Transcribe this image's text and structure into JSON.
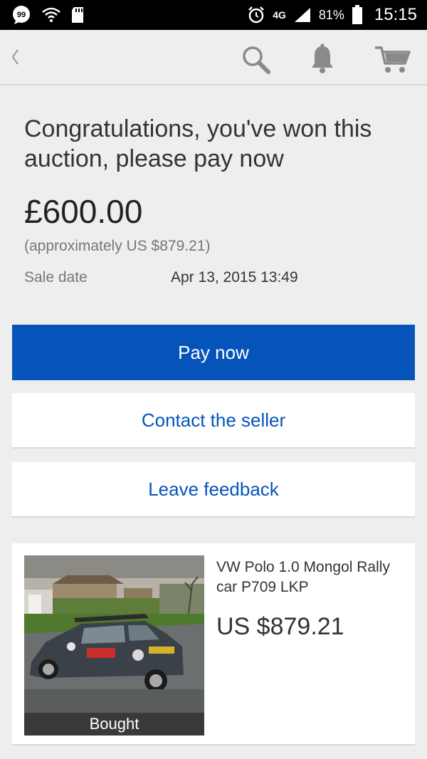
{
  "status_bar": {
    "network": "4G",
    "battery": "81%",
    "time": "15:15"
  },
  "nav": {
    "icons": [
      "back-icon",
      "search-icon",
      "bell-icon",
      "cart-icon"
    ]
  },
  "main": {
    "title": "Congratulations, you've won this auction, please pay now",
    "price": "£600.00",
    "approx": "(approximately US $879.21)",
    "sale_date_label": "Sale date",
    "sale_date_value": "Apr 13, 2015 13:49"
  },
  "buttons": {
    "pay_now": "Pay now",
    "contact_seller": "Contact the seller",
    "leave_feedback": "Leave feedback"
  },
  "item": {
    "title": "VW Polo 1.0 Mongol Rally car P709 LKP",
    "price": "US $879.21",
    "status_label": "Bought"
  },
  "colors": {
    "accent": "#0654ba",
    "background": "#eeeeee"
  }
}
